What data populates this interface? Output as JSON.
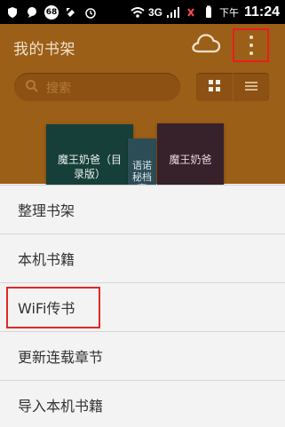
{
  "status_bar": {
    "notification_badge": "68",
    "network": "3G",
    "time_prefix": "下午",
    "time": "11:24",
    "icons": [
      "shield-icon",
      "chat-bubble-icon",
      "badge-icon",
      "sync-icon",
      "alarm-icon",
      "wifi-icon",
      "signal-icon",
      "battery-icon"
    ]
  },
  "header": {
    "title": "我的书架",
    "cloud_icon": "cloud-icon",
    "menu_icon": "more-vertical-icon"
  },
  "search": {
    "placeholder": "搜索"
  },
  "view_toggle": {
    "options": [
      "grid-view-icon",
      "list-view-icon"
    ]
  },
  "books": [
    {
      "title": "魔王奶爸（目录版）"
    },
    {
      "title": "语诺秘档案"
    },
    {
      "title": "魔王奶爸"
    }
  ],
  "overflow_menu": {
    "items": [
      {
        "label": "整理书架"
      },
      {
        "label": "本机书籍"
      },
      {
        "label": "WiFi传书"
      },
      {
        "label": "更新连载章节"
      },
      {
        "label": "导入本机书籍"
      }
    ]
  },
  "colors": {
    "header_bg": "#9b5f18",
    "highlight": "#e81e1e",
    "menu_bg": "#f3f3f3"
  }
}
